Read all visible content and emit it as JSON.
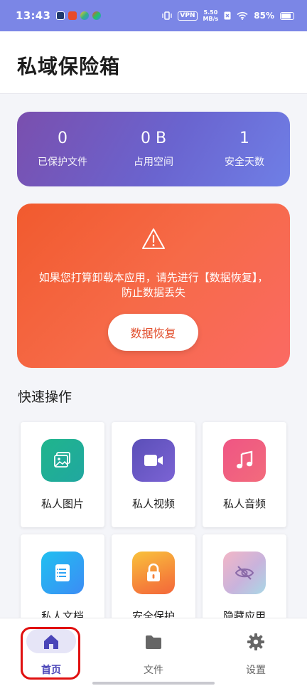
{
  "status_bar": {
    "time": "13:43",
    "vpn": "VPN",
    "speed_value": "5.50",
    "speed_unit": "MB/s",
    "battery": "85%"
  },
  "header": {
    "title": "私域保险箱"
  },
  "stats": {
    "items": [
      {
        "value": "0",
        "label": "已保护文件"
      },
      {
        "value": "0 B",
        "label": "占用空间"
      },
      {
        "value": "1",
        "label": "安全天数"
      }
    ]
  },
  "warning": {
    "icon": "warning-triangle-icon",
    "message": "如果您打算卸载本应用，请先进行【数据恢复】，防止数据丢失",
    "button_label": "数据恢复"
  },
  "quick_actions": {
    "title": "快速操作",
    "items": [
      {
        "label": "私人图片",
        "icon": "image-icon",
        "color": "#22b089"
      },
      {
        "label": "私人视频",
        "icon": "video-icon",
        "color": "#6b58c4"
      },
      {
        "label": "私人音频",
        "icon": "music-icon",
        "color": "#ee5a8c"
      },
      {
        "label": "私人文档",
        "icon": "document-icon",
        "color": "#2fa4f5"
      },
      {
        "label": "安全保护",
        "icon": "lock-icon",
        "color": "#f57f3a"
      },
      {
        "label": "隐藏应用",
        "icon": "eye-off-icon",
        "color": "#c0a9d6"
      }
    ]
  },
  "bottom_nav": {
    "items": [
      {
        "label": "首页",
        "icon": "home-icon",
        "active": true
      },
      {
        "label": "文件",
        "icon": "folder-icon",
        "active": false
      },
      {
        "label": "设置",
        "icon": "gear-icon",
        "active": false
      }
    ]
  },
  "colors": {
    "accent": "#4a45b8",
    "status_bar": "#7b86e6",
    "warning": "#f2633c",
    "highlight": "#e01010"
  }
}
